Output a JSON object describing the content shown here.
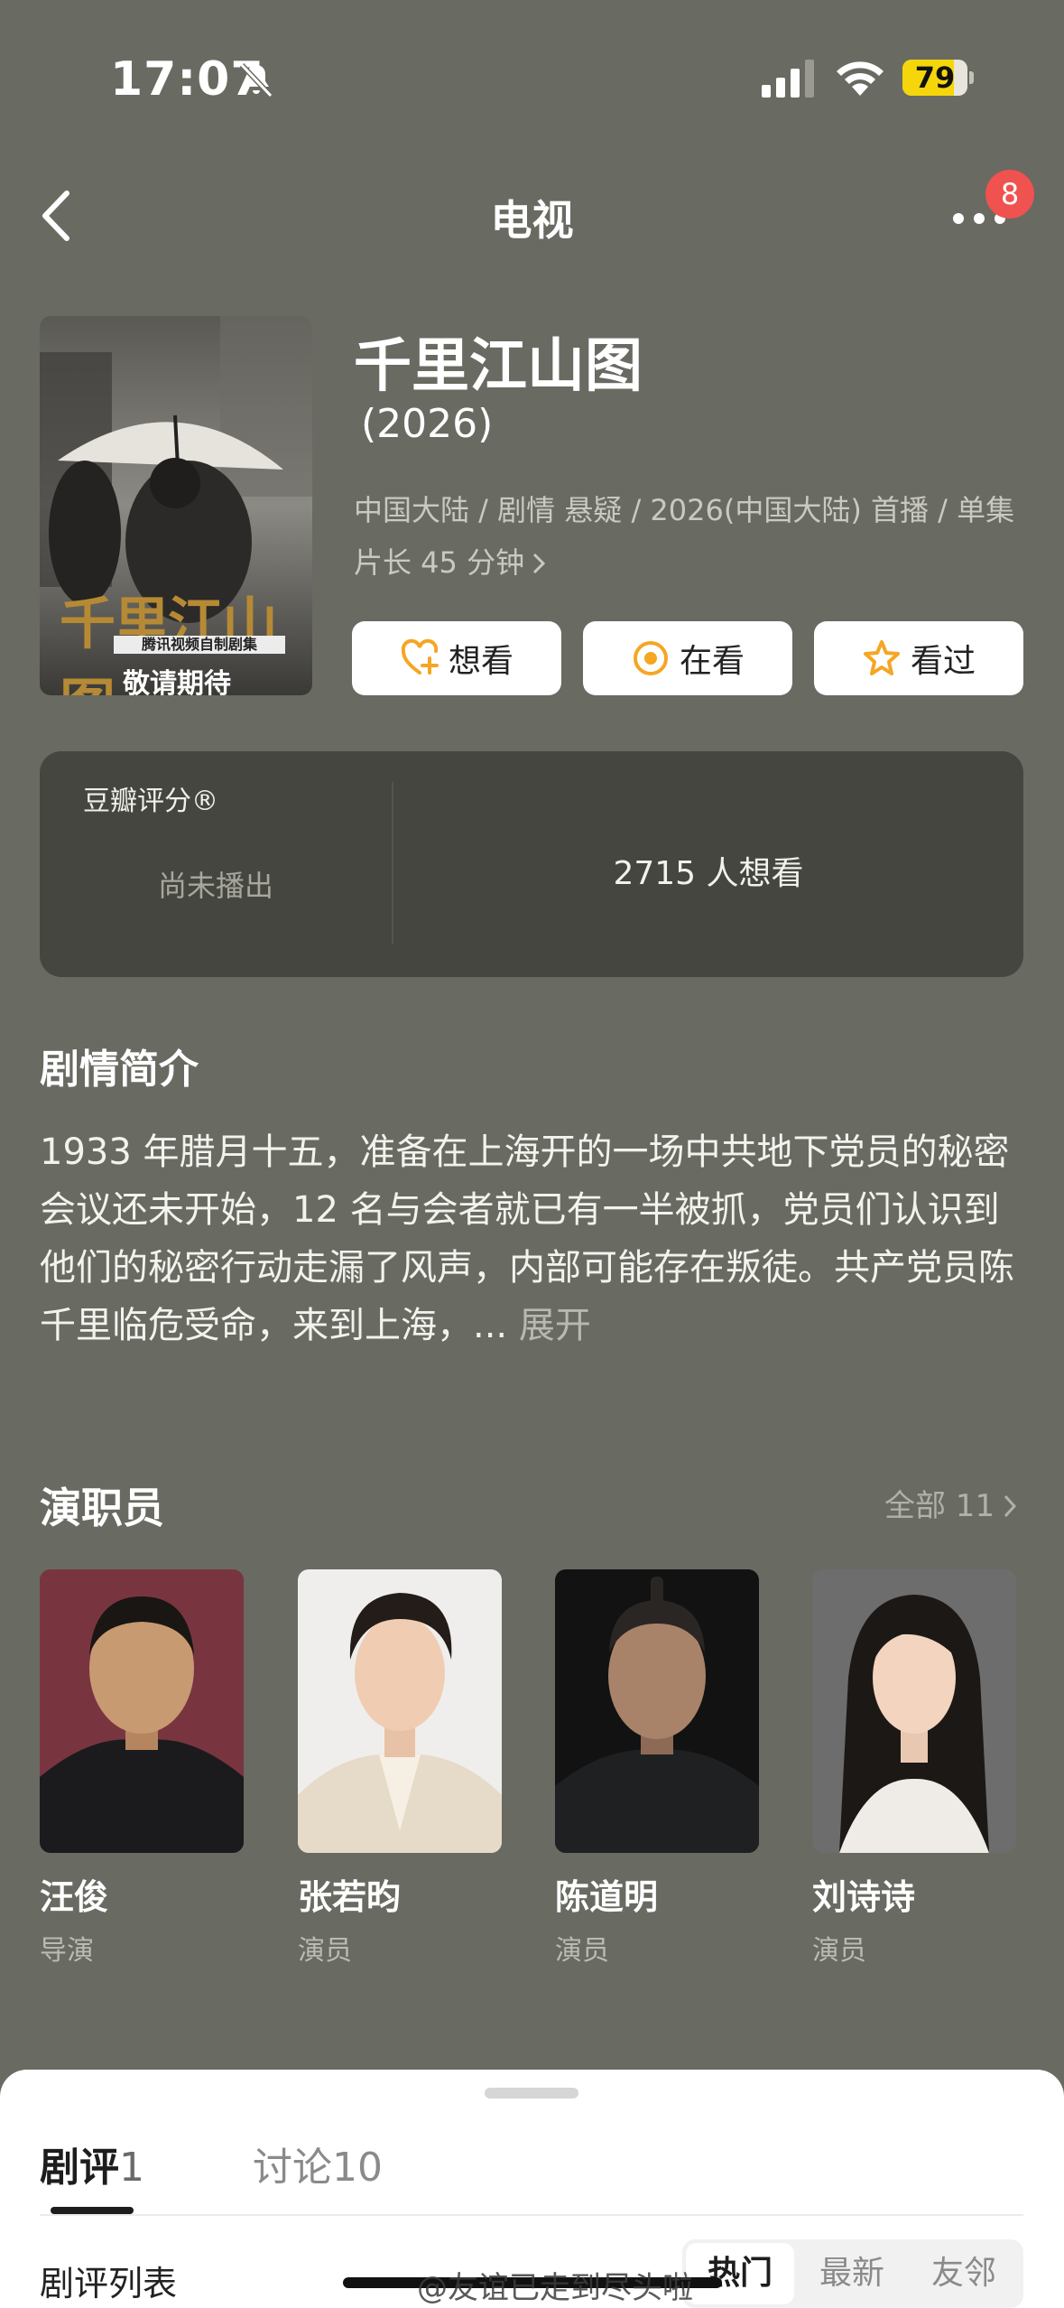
{
  "status_bar": {
    "time": "17:07",
    "battery": "79",
    "battery_level": 0.79,
    "icons": [
      "bell-slash-icon",
      "cellular-signal-icon",
      "wifi-icon",
      "battery-icon"
    ]
  },
  "nav": {
    "title": "电视",
    "badge": "8",
    "icons": [
      "chevron-left-icon",
      "more-dots-icon"
    ]
  },
  "poster": {
    "calligraphy": "千里江山图",
    "caption": "腾讯视频自制剧集",
    "tag": "敬请期待"
  },
  "movie": {
    "title": "千里江山图",
    "year": "(2026)",
    "meta": "中国大陆 / 剧情 悬疑 / 2026(中国大陆) 首播 / 单集片长 45 分钟"
  },
  "actions": {
    "want": "想看",
    "watching": "在看",
    "watched": "看过",
    "icons": [
      "heart-plus-icon",
      "target-circle-icon",
      "star-icon"
    ]
  },
  "rating": {
    "label": "豆瓣评分®",
    "status": "尚未播出",
    "wants": "2715 人想看"
  },
  "synopsis": {
    "title": "剧情简介",
    "text": "1933 年腊月十五，准备在上海开的一场中共地下党员的秘密会议还未开始，12 名与会者就已有一半被抓，党员们认识到他们的秘密行动走漏了风声，内部可能存在叛徒。共产党员陈千里临危受命，来到上海，... ",
    "expand": "展开"
  },
  "cast": {
    "title": "演职员",
    "all": "全部 11",
    "members": [
      {
        "name": "汪俊",
        "role": "导演"
      },
      {
        "name": "张若昀",
        "role": "演员"
      },
      {
        "name": "陈道明",
        "role": "演员"
      },
      {
        "name": "刘诗诗",
        "role": "演员"
      }
    ]
  },
  "sheet": {
    "tabs": [
      {
        "label": "剧评",
        "count": "1"
      },
      {
        "label": "讨论",
        "count": "10"
      }
    ],
    "list_title": "剧评列表",
    "sort": [
      "热门",
      "最新",
      "友邻"
    ],
    "watermark": "@友谊已走到尽头啦"
  },
  "colors": {
    "background": "#696a62",
    "card": "#464640",
    "accent": "#f5a623",
    "badge": "#f0524f"
  }
}
